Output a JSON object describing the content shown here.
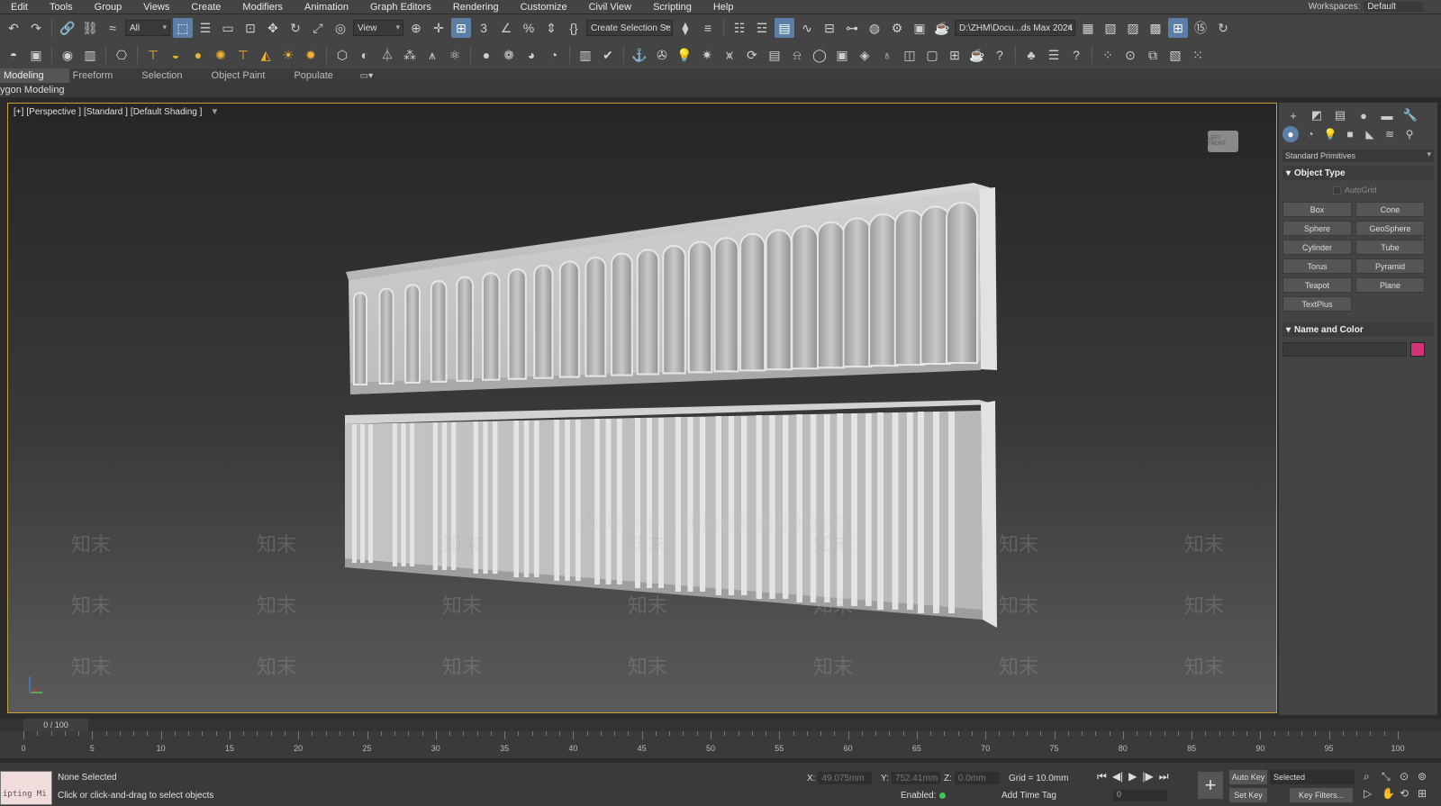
{
  "menu": [
    "Edit",
    "Tools",
    "Group",
    "Views",
    "Create",
    "Modifiers",
    "Animation",
    "Graph Editors",
    "Rendering",
    "Customize",
    "Civil View",
    "Scripting",
    "Help"
  ],
  "workspace": {
    "label": "Workspaces:",
    "value": "Default"
  },
  "toolbar": {
    "filter_value": "All",
    "refcoord_value": "View",
    "selection_set": "Create Selection Se",
    "project_path": "D:\\ZHM\\Docu...ds Max 2024"
  },
  "ribbon": {
    "tabs": [
      "Modeling",
      "Freeform",
      "Selection",
      "Object Paint",
      "Populate"
    ],
    "sub_label": "ygon Modeling"
  },
  "viewport": {
    "labels": [
      "[+]",
      "[Perspective ]",
      "[Standard ]",
      "[Default Shading ]"
    ],
    "watermark_center": "水印保护区，画质会受到部分影响",
    "watermark_text": "知末",
    "viewcube_text": "LEFT FRONT",
    "upper_panel_arches": 24,
    "lower_panel_pilaster_groups": 15
  },
  "command_panel": {
    "category": "Standard Primitives",
    "object_type_title": "Object Type",
    "autogrid_label": "AutoGrid",
    "buttons": [
      "Box",
      "Cone",
      "Sphere",
      "GeoSphere",
      "Cylinder",
      "Tube",
      "Torus",
      "Pyramid",
      "Teapot",
      "Plane",
      "TextPlus"
    ],
    "name_color_title": "Name and Color",
    "object_color": "#d1327a"
  },
  "timeline": {
    "frame_display": "0 / 100",
    "ticks": [
      0,
      5,
      10,
      15,
      20,
      25,
      30,
      35,
      40,
      45,
      50,
      55,
      60,
      65,
      70,
      75,
      80,
      85,
      90,
      95,
      100
    ]
  },
  "status": {
    "maxscript_text": "ipting Mi",
    "selection": "None Selected",
    "prompt": "Click or click-and-drag to select objects",
    "x_label": "X:",
    "x_value": "49.075mm",
    "y_label": "Y:",
    "y_value": "752.41mm",
    "z_label": "Z:",
    "z_value": "0.0mm",
    "grid": "Grid = 10.0mm",
    "enabled_label": "Enabled:",
    "add_time_tag": "Add Time Tag",
    "auto_key": "Auto Key",
    "set_key": "Set Key",
    "selected_dd": "Selected",
    "key_filters": "Key Filters...",
    "frame_value": "0"
  }
}
